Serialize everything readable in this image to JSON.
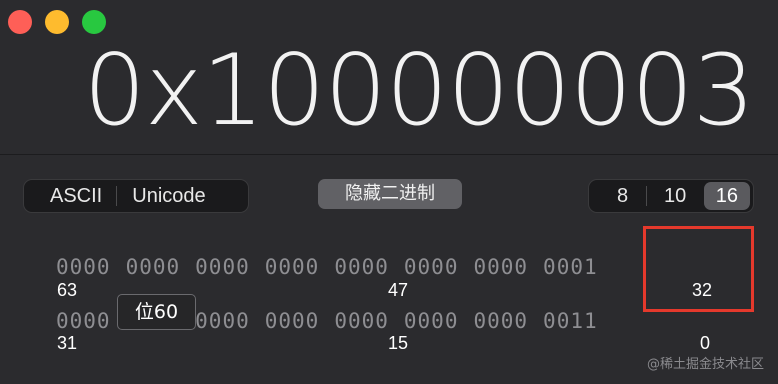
{
  "window": {
    "controls": [
      "close",
      "minimize",
      "zoom"
    ],
    "colors": {
      "close": "#fe5f57",
      "minimize": "#febb2e",
      "zoom": "#28c840"
    }
  },
  "display": {
    "value": "0x100000003"
  },
  "encoding": {
    "options": [
      "ASCII",
      "Unicode"
    ]
  },
  "binary_toggle": {
    "label": "隐藏二进制"
  },
  "base": {
    "options": [
      "8",
      "10",
      "16"
    ],
    "selected": "16"
  },
  "bits": {
    "row1": [
      "0000",
      "0000",
      "0000",
      "0000",
      "0000",
      "0000",
      "0000",
      "0001"
    ],
    "row2": [
      "0000",
      "0000",
      "0000",
      "0000",
      "0000",
      "0000",
      "0000",
      "0011"
    ],
    "labels": {
      "r1_left": "63",
      "r1_mid": "47",
      "r1_right": "32",
      "r2_left": "31",
      "r2_mid": "15",
      "r2_right": "0"
    }
  },
  "tooltip": {
    "text": "位60"
  },
  "annotation": {
    "highlight_color": "#e5392c"
  },
  "watermark": {
    "text": "@稀土掘金技术社区"
  }
}
